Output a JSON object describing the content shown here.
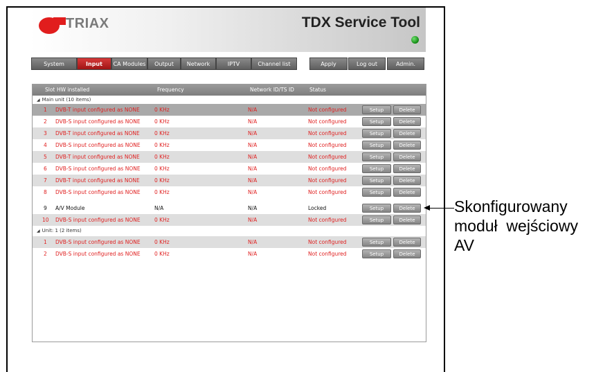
{
  "header": {
    "brand": "TRIAX",
    "app_title": "TDX Service Tool",
    "status_led_color": "#1a9a1a"
  },
  "tabs": [
    {
      "label": "System",
      "active": false
    },
    {
      "label": "Input",
      "active": true
    },
    {
      "label": "CA Modules",
      "active": false
    },
    {
      "label": "Output",
      "active": false
    },
    {
      "label": "Network",
      "active": false
    },
    {
      "label": "IPTV",
      "active": false
    },
    {
      "label": "Channel list",
      "active": false
    }
  ],
  "actions": {
    "apply": "Apply",
    "logout": "Log out",
    "admin": "Admin."
  },
  "table": {
    "columns": {
      "slot": "Slot",
      "hw": "HW installed",
      "frequency": "Frequency",
      "network": "Network ID/TS ID",
      "status": "Status"
    },
    "groups": [
      {
        "label": "Main unit (10 items)",
        "rows": [
          {
            "slot": "1",
            "hw": "DVB-T input configured as NONE",
            "frequency": "0 KHz",
            "network": "N/A",
            "status": "Not configured",
            "setup": "Setup",
            "delete": "Delete"
          },
          {
            "slot": "2",
            "hw": "DVB-S input configured as NONE",
            "frequency": "0 KHz",
            "network": "N/A",
            "status": "Not configured",
            "setup": "Setup",
            "delete": "Delete"
          },
          {
            "slot": "3",
            "hw": "DVB-T input configured as NONE",
            "frequency": "0 KHz",
            "network": "N/A",
            "status": "Not configured",
            "setup": "Setup",
            "delete": "Delete"
          },
          {
            "slot": "4",
            "hw": "DVB-S input configured as NONE",
            "frequency": "0 KHz",
            "network": "N/A",
            "status": "Not configured",
            "setup": "Setup",
            "delete": "Delete"
          },
          {
            "slot": "5",
            "hw": "DVB-T input configured as NONE",
            "frequency": "0 KHz",
            "network": "N/A",
            "status": "Not configured",
            "setup": "Setup",
            "delete": "Delete"
          },
          {
            "slot": "6",
            "hw": "DVB-S input configured as NONE",
            "frequency": "0 KHz",
            "network": "N/A",
            "status": "Not configured",
            "setup": "Setup",
            "delete": "Delete"
          },
          {
            "slot": "7",
            "hw": "DVB-T input configured as NONE",
            "frequency": "0 KHz",
            "network": "N/A",
            "status": "Not configured",
            "setup": "Setup",
            "delete": "Delete"
          },
          {
            "slot": "8",
            "hw": "DVB-S input configured as NONE",
            "frequency": "0 KHz",
            "network": "N/A",
            "status": "Not configured",
            "setup": "Setup",
            "delete": "Delete"
          },
          {
            "slot": "9",
            "hw": "A/V Module",
            "frequency": "N/A",
            "network": "N/A",
            "status": "Locked",
            "setup": "Setup",
            "delete": "Delete"
          },
          {
            "slot": "10",
            "hw": "DVB-S input configured as NONE",
            "frequency": "0 KHz",
            "network": "N/A",
            "status": "Not configured",
            "setup": "Setup",
            "delete": "Delete"
          }
        ]
      },
      {
        "label": "Unit: 1 (2 items)",
        "rows": [
          {
            "slot": "1",
            "hw": "DVB-S input configured as NONE",
            "frequency": "0 KHz",
            "network": "N/A",
            "status": "Not configured",
            "setup": "Setup",
            "delete": "Delete"
          },
          {
            "slot": "2",
            "hw": "DVB-S input configured as NONE",
            "frequency": "0 KHz",
            "network": "N/A",
            "status": "Not configured",
            "setup": "Setup",
            "delete": "Delete"
          }
        ]
      }
    ]
  },
  "callout": {
    "line1": "Skonfigurowany",
    "line2": "moduł  wejściowy",
    "line3": "AV"
  }
}
